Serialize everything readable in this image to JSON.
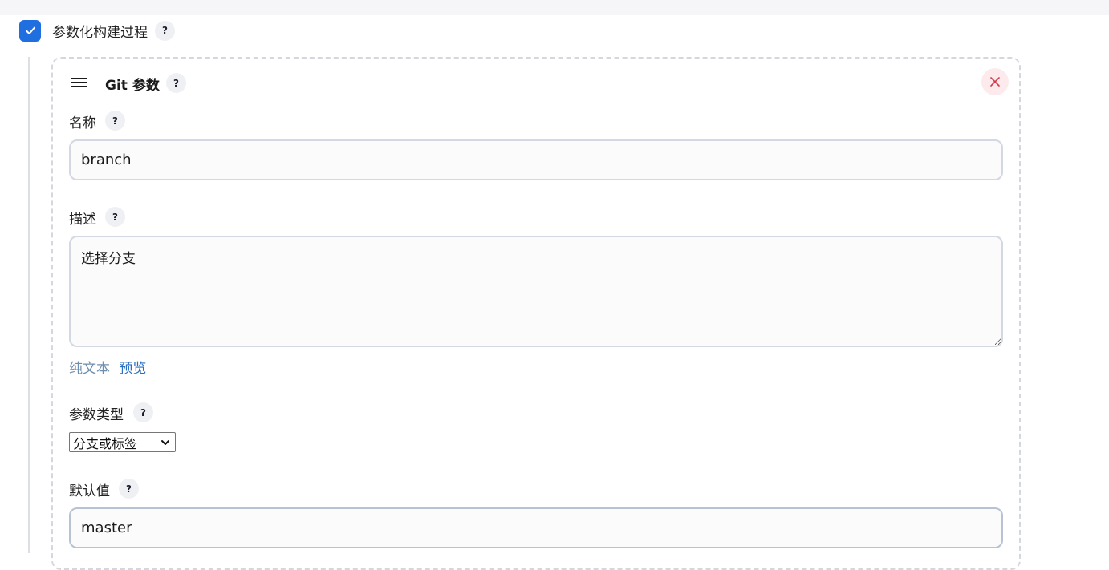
{
  "section": {
    "checkbox_checked": true,
    "checkbox_label": "参数化构建过程",
    "help": "?"
  },
  "card": {
    "title": "Git 参数",
    "help": "?",
    "delete_icon": "close-icon",
    "drag_icon": "hamburger-icon"
  },
  "fields": {
    "name": {
      "label": "名称",
      "help": "?",
      "value": "branch"
    },
    "description": {
      "label": "描述",
      "help": "?",
      "value": "选择分支"
    },
    "format_links": {
      "plain_text": "纯文本",
      "preview": "预览"
    },
    "param_type": {
      "label": "参数类型",
      "help": "?",
      "selected": "分支或标签"
    },
    "default_value": {
      "label": "默认值",
      "help": "?",
      "value": "master"
    }
  },
  "colors": {
    "accent": "#1f6fe0",
    "delete_tint": "#fdeaec",
    "delete_icon": "#d33a4a",
    "link": "#2a6fc0"
  }
}
